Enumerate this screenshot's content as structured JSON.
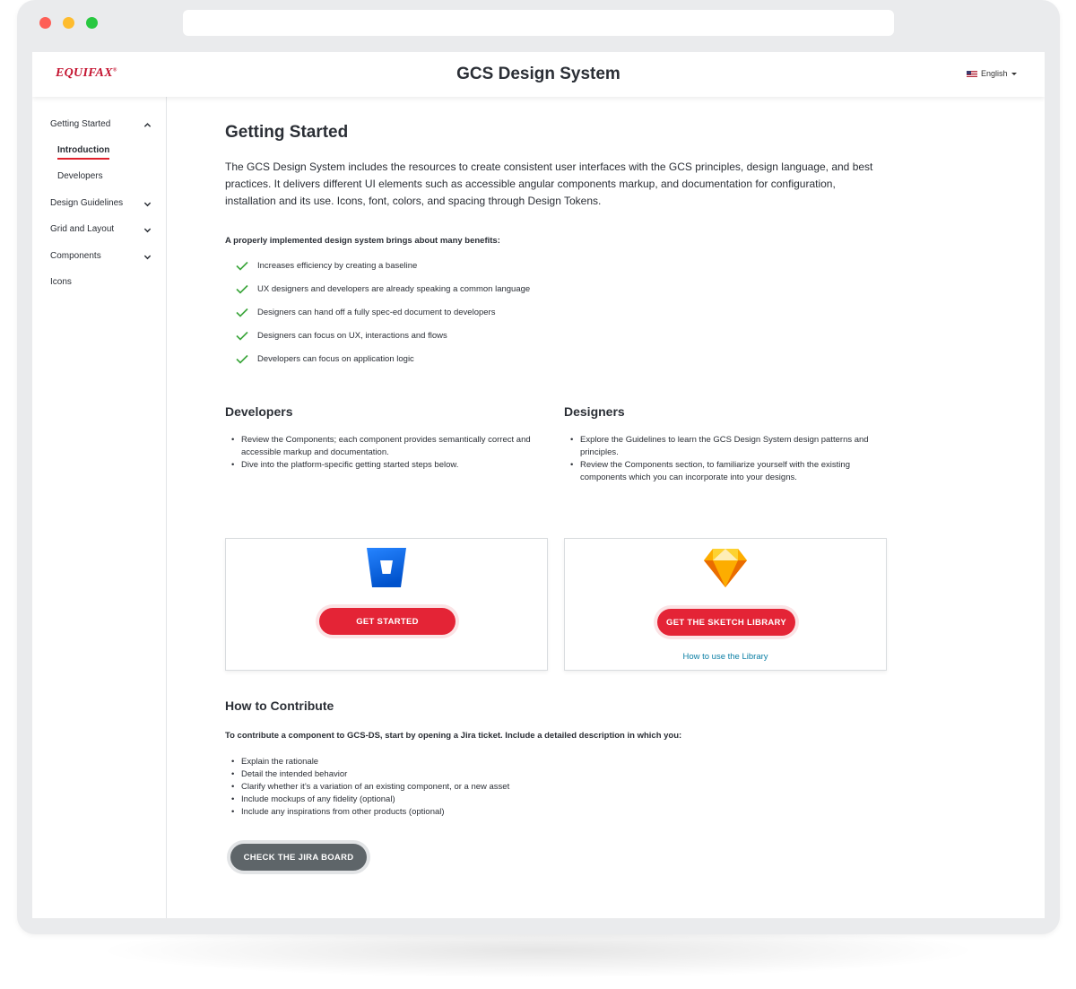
{
  "header": {
    "logo_text": "EQUIFAX",
    "logo_mark": "®",
    "title": "GCS Design System",
    "language": "English"
  },
  "sidebar": {
    "items": [
      {
        "label": "Getting Started",
        "expanded": true
      },
      {
        "label": "Introduction",
        "active": true
      },
      {
        "label": "Developers"
      },
      {
        "label": "Design Guidelines",
        "expanded": false
      },
      {
        "label": "Grid and Layout",
        "expanded": false
      },
      {
        "label": "Components",
        "expanded": false
      },
      {
        "label": "Icons"
      }
    ]
  },
  "main": {
    "title": "Getting Started",
    "intro": "The GCS Design System includes the resources to create consistent user interfaces with the GCS principles, design language, and best practices. It delivers different UI elements such as accessible angular components markup, and documentation for configuration, installation and its use. Icons, font, colors, and spacing through Design Tokens.",
    "benefits_heading": "A properly implemented design system brings about many benefits:",
    "benefits": [
      "Increases efficiency by creating a baseline",
      "UX designers and developers are already speaking a common language",
      "Designers can hand off a fully spec-ed document to developers",
      "Designers can focus on UX, interactions and flows",
      "Developers can focus on application logic"
    ],
    "developers": {
      "heading": "Developers",
      "bullets": [
        "Review the Components; each component provides semantically correct and accessible markup and documentation.",
        "Dive into the platform-specific getting started steps below."
      ],
      "button": "GET STARTED",
      "icon": "bitbucket-icon"
    },
    "designers": {
      "heading": "Designers",
      "bullets": [
        "Explore the Guidelines to learn the GCS Design System design patterns and principles.",
        "Review the Components section, to familiarize yourself with the existing components which you can incorporate into your designs."
      ],
      "button": "GET THE SKETCH LIBRARY",
      "link": "How to use the Library",
      "icon": "sketch-icon"
    },
    "contribute": {
      "heading": "How to Contribute",
      "intro": "To contribute a component to GCS-DS, start by opening a Jira ticket. Include a detailed description in which you:",
      "bullets": [
        "Explain the rationale",
        "Detail the intended behavior",
        "Clarify whether it’s a variation of an existing component, or a new asset",
        "Include mockups of any fidelity (optional)",
        "Include any inspirations from other products (optional)"
      ],
      "button": "CHECK THE JIRA BOARD"
    }
  },
  "colors": {
    "brand_red": "#c4122f",
    "button_red": "#e42436",
    "check_green": "#3aa53a",
    "link_blue": "#0a7ea4",
    "button_gray": "#5e6569"
  }
}
